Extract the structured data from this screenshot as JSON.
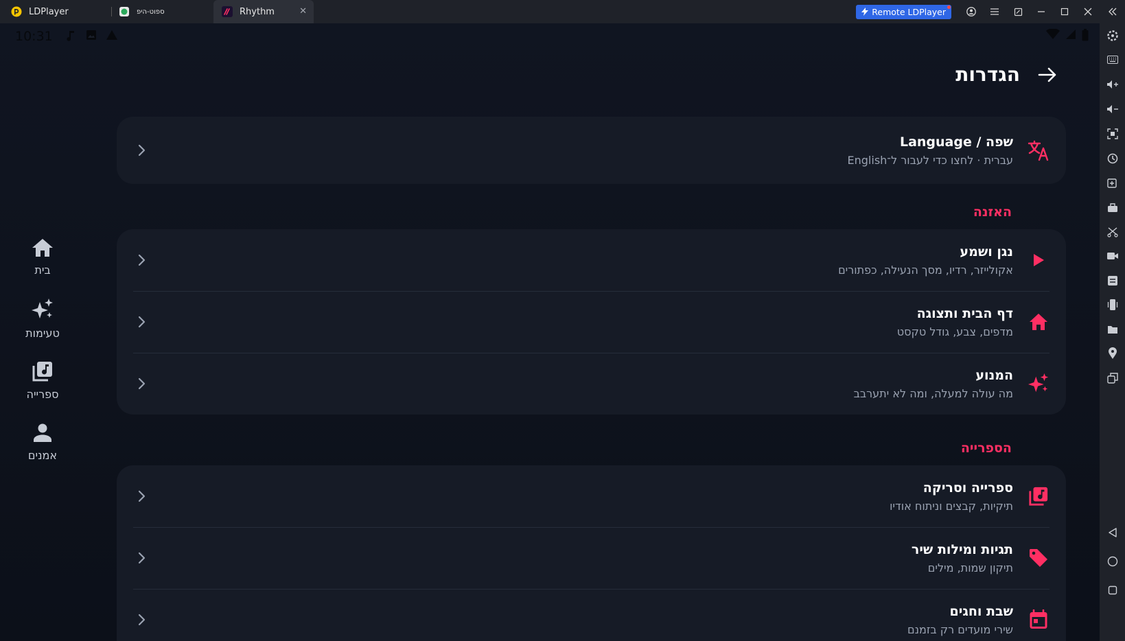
{
  "window": {
    "tabs": [
      {
        "label": "LDPlayer"
      },
      {
        "label": "ספוט-היפ"
      },
      {
        "label": "Rhythm"
      }
    ],
    "remote_button": "Remote LDPlayer"
  },
  "status_bar": {
    "time": "10:31"
  },
  "header": {
    "title": "הגדרות"
  },
  "nav": {
    "items": [
      {
        "label": "בית"
      },
      {
        "label": "טעימות"
      },
      {
        "label": "ספרייה"
      },
      {
        "label": "אמנים"
      }
    ]
  },
  "language_card": {
    "title": "שפה / Language",
    "subtitle": "עברית · לחצו כדי לעבור ל־English"
  },
  "sections": [
    {
      "title": "האזנה",
      "items": [
        {
          "title": "נגן ושמע",
          "subtitle": "אקולייזר, רדיו, מסך הנעילה, כפתורים",
          "icon": "play-icon"
        },
        {
          "title": "דף הבית ותצוגה",
          "subtitle": "מדפים, צבע, גודל טקסט",
          "icon": "home-icon"
        },
        {
          "title": "המנוע",
          "subtitle": "מה עולה למעלה, ומה לא יתערבב",
          "icon": "sparkle-icon"
        }
      ]
    },
    {
      "title": "הספרייה",
      "items": [
        {
          "title": "ספרייה וסריקה",
          "subtitle": "תיקיות, קבצים וניתוח אודיו",
          "icon": "library-music-icon"
        },
        {
          "title": "תגיות ומילות שיר",
          "subtitle": "תיקון שמות, מילים",
          "icon": "tag-icon"
        },
        {
          "title": "שבת וחגים",
          "subtitle": "שירי מועדים רק בזמנם",
          "icon": "calendar-icon"
        }
      ]
    }
  ],
  "colors": {
    "accent": "#ff2f63",
    "background": "#0f131c",
    "card": "#161b26",
    "nav_icon": "#c7ccd6"
  }
}
